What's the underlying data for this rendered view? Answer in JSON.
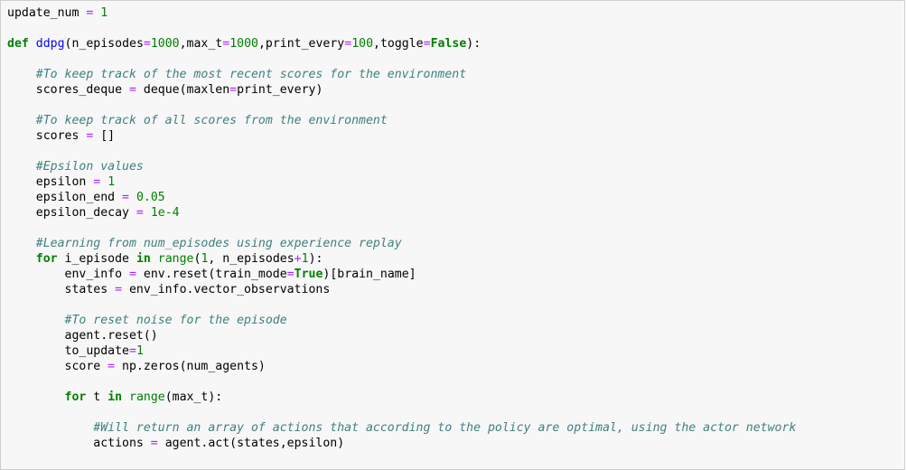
{
  "code_cell": {
    "lines": [
      [
        [
          "update_num ",
          "plain"
        ],
        [
          "=",
          "op"
        ],
        [
          " ",
          "plain"
        ],
        [
          "1",
          "num"
        ]
      ],
      [],
      [
        [
          "def",
          "kw"
        ],
        [
          " ",
          "plain"
        ],
        [
          "ddpg",
          "func"
        ],
        [
          "(n_episodes",
          "plain"
        ],
        [
          "=",
          "op"
        ],
        [
          "1000",
          "num"
        ],
        [
          ",max_t",
          "plain"
        ],
        [
          "=",
          "op"
        ],
        [
          "1000",
          "num"
        ],
        [
          ",print_every",
          "plain"
        ],
        [
          "=",
          "op"
        ],
        [
          "100",
          "num"
        ],
        [
          ",toggle",
          "plain"
        ],
        [
          "=",
          "op"
        ],
        [
          "False",
          "kw"
        ],
        [
          "):",
          "plain"
        ]
      ],
      [],
      [
        [
          "    ",
          "plain"
        ],
        [
          "#To keep track of the most recent scores for the environment",
          "comment"
        ]
      ],
      [
        [
          "    scores_deque ",
          "plain"
        ],
        [
          "=",
          "op"
        ],
        [
          " deque(maxlen",
          "plain"
        ],
        [
          "=",
          "op"
        ],
        [
          "print_every)",
          "plain"
        ]
      ],
      [],
      [
        [
          "    ",
          "plain"
        ],
        [
          "#To keep track of all scores from the environment",
          "comment"
        ]
      ],
      [
        [
          "    scores ",
          "plain"
        ],
        [
          "=",
          "op"
        ],
        [
          " []",
          "plain"
        ]
      ],
      [],
      [
        [
          "    ",
          "plain"
        ],
        [
          "#Epsilon values",
          "comment"
        ]
      ],
      [
        [
          "    epsilon ",
          "plain"
        ],
        [
          "=",
          "op"
        ],
        [
          " ",
          "plain"
        ],
        [
          "1",
          "num"
        ]
      ],
      [
        [
          "    epsilon_end ",
          "plain"
        ],
        [
          "=",
          "op"
        ],
        [
          " ",
          "plain"
        ],
        [
          "0.05",
          "num"
        ]
      ],
      [
        [
          "    epsilon_decay ",
          "plain"
        ],
        [
          "=",
          "op"
        ],
        [
          " ",
          "plain"
        ],
        [
          "1e-4",
          "num"
        ]
      ],
      [],
      [
        [
          "    ",
          "plain"
        ],
        [
          "#Learning from num_episodes using experience replay",
          "comment"
        ]
      ],
      [
        [
          "    ",
          "plain"
        ],
        [
          "for",
          "kw"
        ],
        [
          " i_episode ",
          "plain"
        ],
        [
          "in",
          "kw"
        ],
        [
          " ",
          "plain"
        ],
        [
          "range",
          "builtin"
        ],
        [
          "(",
          "plain"
        ],
        [
          "1",
          "num"
        ],
        [
          ", n_episodes",
          "plain"
        ],
        [
          "+",
          "op"
        ],
        [
          "1",
          "num"
        ],
        [
          "):",
          "plain"
        ]
      ],
      [
        [
          "        env_info ",
          "plain"
        ],
        [
          "=",
          "op"
        ],
        [
          " env.reset(train_mode",
          "plain"
        ],
        [
          "=",
          "op"
        ],
        [
          "True",
          "kw"
        ],
        [
          ")[brain_name]",
          "plain"
        ]
      ],
      [
        [
          "        states ",
          "plain"
        ],
        [
          "=",
          "op"
        ],
        [
          " env_info.vector_observations",
          "plain"
        ]
      ],
      [],
      [
        [
          "        ",
          "plain"
        ],
        [
          "#To reset noise for the episode",
          "comment"
        ]
      ],
      [
        [
          "        agent.reset()",
          "plain"
        ]
      ],
      [
        [
          "        to_update",
          "plain"
        ],
        [
          "=",
          "op"
        ],
        [
          "1",
          "num"
        ]
      ],
      [
        [
          "        score ",
          "plain"
        ],
        [
          "=",
          "op"
        ],
        [
          " np.zeros(num_agents)",
          "plain"
        ]
      ],
      [],
      [
        [
          "        ",
          "plain"
        ],
        [
          "for",
          "kw"
        ],
        [
          " t ",
          "plain"
        ],
        [
          "in",
          "kw"
        ],
        [
          " ",
          "plain"
        ],
        [
          "range",
          "builtin"
        ],
        [
          "(max_t):",
          "plain"
        ]
      ],
      [],
      [
        [
          "            ",
          "plain"
        ],
        [
          "#Will return an array of actions that according to the policy are optimal, using the actor network",
          "comment"
        ]
      ],
      [
        [
          "            actions ",
          "plain"
        ],
        [
          "=",
          "op"
        ],
        [
          " agent.act(states,epsilon)",
          "plain"
        ]
      ]
    ]
  }
}
